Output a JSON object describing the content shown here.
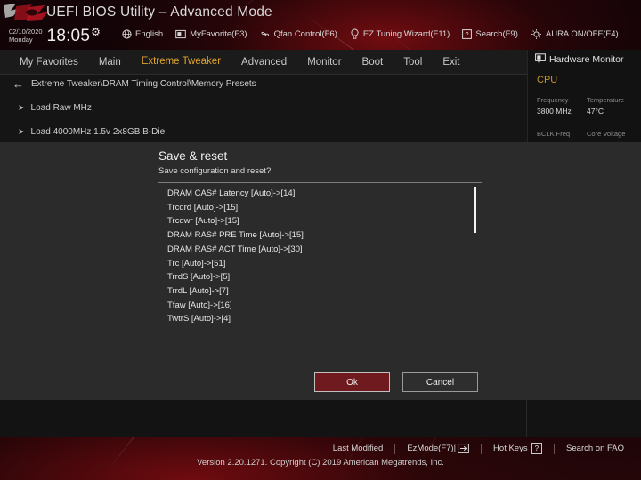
{
  "header": {
    "app_title": "UEFI BIOS Utility – Advanced Mode",
    "date": "02/10/2020",
    "weekday": "Monday",
    "time": "18:05",
    "gear_icon": "gear-icon",
    "items": [
      {
        "icon": "globe-icon",
        "label": "English"
      },
      {
        "icon": "star-icon",
        "label": "MyFavorite(F3)"
      },
      {
        "icon": "fan-icon",
        "label": "Qfan Control(F6)"
      },
      {
        "icon": "bulb-icon",
        "label": "EZ Tuning Wizard(F11)"
      },
      {
        "icon": "search-icon",
        "label": "Search(F9)"
      },
      {
        "icon": "aura-icon",
        "label": "AURA ON/OFF(F4)"
      }
    ]
  },
  "tabs": [
    {
      "label": "My Favorites",
      "active": false
    },
    {
      "label": "Main",
      "active": false
    },
    {
      "label": "Extreme Tweaker",
      "active": true
    },
    {
      "label": "Advanced",
      "active": false
    },
    {
      "label": "Monitor",
      "active": false
    },
    {
      "label": "Boot",
      "active": false
    },
    {
      "label": "Tool",
      "active": false
    },
    {
      "label": "Exit",
      "active": false
    }
  ],
  "content": {
    "breadcrumb": "Extreme Tweaker\\DRAM Timing Control\\Memory Presets",
    "back_icon": "back-arrow-icon",
    "menu_items": [
      {
        "label": "Load Raw MHz"
      },
      {
        "label": "Load 4000MHz 1.5v 2x8GB B-Die"
      }
    ]
  },
  "hardware_monitor": {
    "title": "Hardware Monitor",
    "icon": "monitor-icon",
    "section": "CPU",
    "accent": "#c8952c",
    "fields": [
      {
        "label": "Frequency",
        "value": "3800 MHz"
      },
      {
        "label": "Temperature",
        "value": "47°C"
      },
      {
        "label": "BCLK Freq",
        "value": ""
      },
      {
        "label": "Core Voltage",
        "value": ""
      }
    ]
  },
  "modal": {
    "title": "Save & reset",
    "subtitle": "Save configuration and reset?",
    "changes": [
      "DRAM CAS# Latency [Auto]->[14]",
      "Trcdrd [Auto]->[15]",
      "Trcdwr [Auto]->[15]",
      "DRAM RAS# PRE Time [Auto]->[15]",
      "DRAM RAS# ACT Time [Auto]->[30]",
      "Trc [Auto]->[51]",
      "TrrdS [Auto]->[5]",
      "TrrdL [Auto]->[7]",
      "Tfaw [Auto]->[16]",
      "TwtrS [Auto]->[4]"
    ],
    "ok_label": "Ok",
    "cancel_label": "Cancel",
    "ok_color": "#6e1a1f"
  },
  "footer": {
    "items": [
      {
        "label": "Last Modified",
        "icon": ""
      },
      {
        "label": "EzMode(F7)|",
        "icon": "arrow-right-box-icon"
      },
      {
        "label": "Hot Keys",
        "icon": "question-box-icon"
      },
      {
        "label": "Search on FAQ",
        "icon": ""
      }
    ],
    "version": "Version 2.20.1271. Copyright (C) 2019 American Megatrends, Inc."
  }
}
